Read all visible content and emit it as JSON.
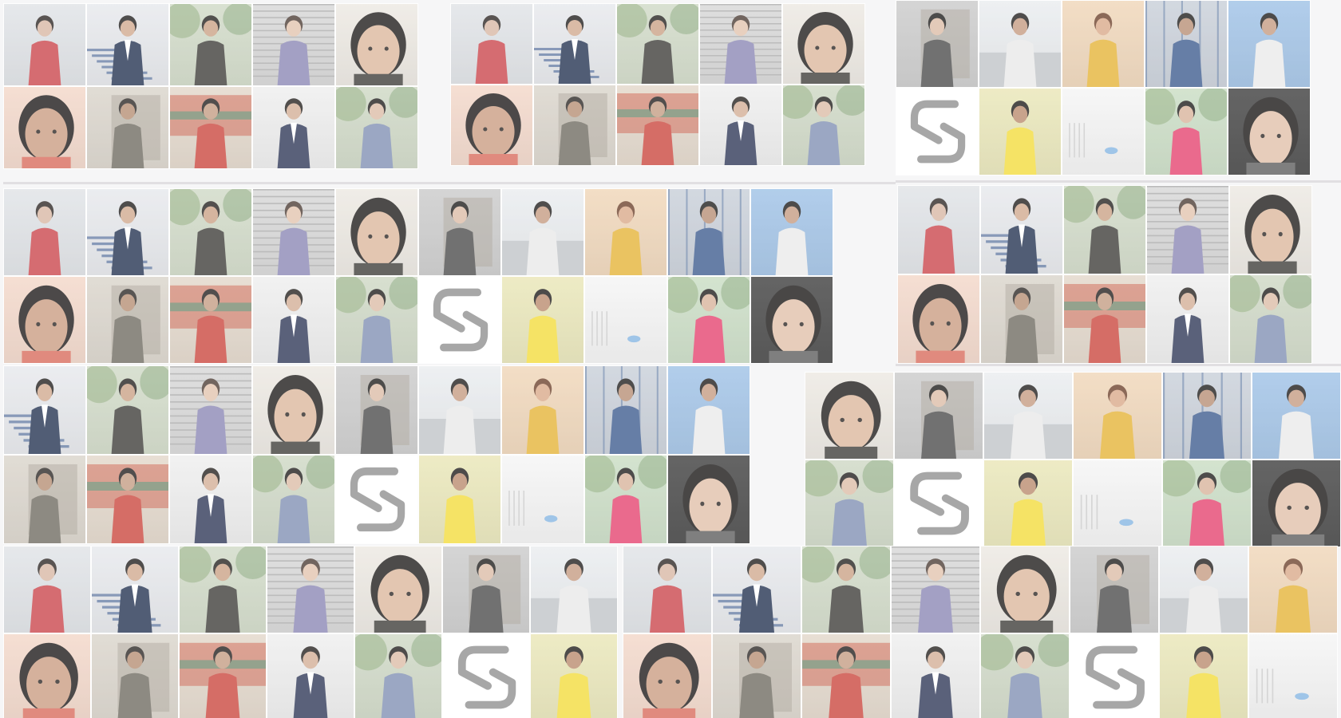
{
  "page": {
    "title": "",
    "background": "#f4f4f5",
    "veil_opacity": 0.22
  },
  "photo_types": {
    "A": {
      "subject": "man-selfie-balcony",
      "bg": "#dfe2e6",
      "accent": "#c9434a",
      "skin": "#d8b7a3",
      "hair": "#2b2522"
    },
    "B": {
      "subject": "man-suit-stairs",
      "bg": "#e6e8ec",
      "accent": "#20304f",
      "skin": "#d0a88e",
      "hair": "#1e1b1a"
    },
    "C": {
      "subject": "man-garden-selfie",
      "bg": "#cfd9c5",
      "accent": "#3c3a37",
      "skin": "#caa084",
      "hair": "#221f1d"
    },
    "D": {
      "subject": "woman-shutter-wall",
      "bg": "#d6d6d6",
      "accent": "#8a86b4",
      "skin": "#e2c3ad",
      "hair": "#4a3a33"
    },
    "E": {
      "subject": "man-closeup-tilted",
      "bg": "#ece8e1",
      "accent": "#3b3a36",
      "skin": "#dbb79c",
      "hair": "#1b1918"
    },
    "F": {
      "subject": "man-portrait-orange",
      "bg": "#f3d6c7",
      "accent": "#d86a5a",
      "skin": "#c99b80",
      "hair": "#1a1716"
    },
    "G": {
      "subject": "man-old-building",
      "bg": "#d9d3c9",
      "accent": "#6d6a5f",
      "skin": "#b58d73",
      "hair": "#2a2623"
    },
    "H": {
      "subject": "man-colorful-bus",
      "bg": "#e2d6c8",
      "accent": "#c9443c",
      "skin": "#c39b82",
      "hair": "#211d1b"
    },
    "I": {
      "subject": "man-suit-standing",
      "bg": "#eeeeee",
      "accent": "#2c3555",
      "skin": "#d2ad95",
      "hair": "#221e1c"
    },
    "J": {
      "subject": "woman-trees",
      "bg": "#cdd7c3",
      "accent": "#7f8fb2",
      "skin": "#dcbca6",
      "hair": "#1d1a19"
    },
    "K": {
      "subject": "woman-stone-wall",
      "bg": "#c9c9c9",
      "accent": "#4a4a4a",
      "skin": "#dcbca6",
      "hair": "#1c1a19"
    },
    "L": {
      "subject": "man-road",
      "bg": "#e9ecef",
      "accent": "#e8e8e8",
      "skin": "#c59a80",
      "hair": "#1e1b1a"
    },
    "M": {
      "subject": "woman-yellow-dress",
      "bg": "#f0d5b6",
      "accent": "#e4b235",
      "skin": "#d9a888",
      "hair": "#6b3f2a"
    },
    "N": {
      "subject": "man-scaffold",
      "bg": "#c7ced8",
      "accent": "#3c5a8e",
      "skin": "#b68e74",
      "hair": "#1d1b1a"
    },
    "O": {
      "subject": "man-sky-checkered",
      "bg": "#9cc0e6",
      "accent": "#e9e9e9",
      "skin": "#c59a80",
      "hair": "#1b1918"
    },
    "P": {
      "subject": "sk-logo",
      "bg": "#ffffff",
      "accent": "#8f8f8f",
      "skin": "#ffffff",
      "hair": "#8f8f8f"
    },
    "Q": {
      "subject": "man-yellow-shirt",
      "bg": "#e9e6b5",
      "accent": "#f2dc3a",
      "skin": "#b9896c",
      "hair": "#1b1918"
    },
    "R": {
      "subject": "white-fence-blur",
      "bg": "#f5f5f5",
      "accent": "#6aa8e0",
      "skin": "#ffffff",
      "hair": "#c9c9c9"
    },
    "S": {
      "subject": "woman-pink-scooters",
      "bg": "#c8dcc2",
      "accent": "#e4416d",
      "skin": "#d8b29a",
      "hair": "#1c1a19"
    },
    "T": {
      "subject": "woman-closeup-dark",
      "bg": "#3a3a3a",
      "accent": "#5b5b5b",
      "skin": "#e0bfa8",
      "hair": "#161413"
    }
  },
  "panels": [
    {
      "name": "panel-top-left",
      "rows": [
        [
          "A",
          "B",
          "C",
          "D",
          "E"
        ],
        [
          "F",
          "G",
          "H",
          "I",
          "J"
        ]
      ]
    },
    {
      "name": "panel-top-mid",
      "rows": [
        [
          "A",
          "B",
          "C",
          "D",
          "E"
        ],
        [
          "F",
          "G",
          "H",
          "I",
          "J"
        ]
      ]
    },
    {
      "name": "panel-top-right",
      "rows": [
        [
          "K",
          "L",
          "M",
          "N",
          "O"
        ],
        [
          "P",
          "Q",
          "R",
          "S",
          "T"
        ]
      ]
    },
    {
      "name": "panel-mid-left",
      "rows": [
        [
          "A",
          "B",
          "C",
          "D",
          "E",
          "K",
          "L",
          "M",
          "N",
          "O"
        ],
        [
          "F",
          "G",
          "H",
          "I",
          "J",
          "P",
          "Q",
          "R",
          "S",
          "T"
        ]
      ]
    },
    {
      "name": "panel-mid-right",
      "rows": [
        [
          "A",
          "B",
          "C",
          "D",
          "E"
        ],
        [
          "F",
          "G",
          "H",
          "I",
          "J"
        ]
      ]
    },
    {
      "name": "panel-row3-left",
      "rows": [
        [
          "B",
          "C",
          "D",
          "E",
          "K",
          "L",
          "M",
          "N",
          "O"
        ],
        [
          "G",
          "H",
          "I",
          "J",
          "P",
          "Q",
          "R",
          "S",
          "T"
        ]
      ]
    },
    {
      "name": "panel-row3-right",
      "rows": [
        [
          "E",
          "K",
          "L",
          "M",
          "N",
          "O"
        ],
        [
          "J",
          "P",
          "Q",
          "R",
          "S",
          "T"
        ]
      ]
    },
    {
      "name": "panel-bottom-left",
      "rows": [
        [
          "A",
          "B",
          "C",
          "D",
          "E",
          "K",
          "L"
        ],
        [
          "F",
          "G",
          "H",
          "I",
          "J",
          "P",
          "Q"
        ]
      ]
    },
    {
      "name": "panel-bottom-right",
      "rows": [
        [
          "A",
          "B",
          "C",
          "D",
          "E",
          "K",
          "L",
          "M"
        ],
        [
          "F",
          "G",
          "H",
          "I",
          "J",
          "P",
          "Q",
          "R"
        ]
      ]
    }
  ]
}
